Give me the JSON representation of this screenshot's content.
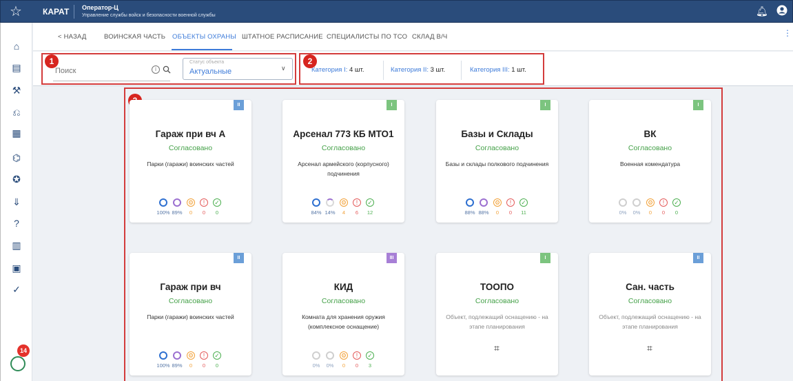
{
  "header": {
    "brand": "КАРАТ",
    "role": "Оператор-Ц",
    "department": "Управление службы войск и безопасности военной службы"
  },
  "tabs": {
    "back": "< НАЗАД",
    "items": [
      "ВОИНСКАЯ ЧАСТЬ",
      "ОБЪЕКТЫ ОХРАНЫ",
      "ШТАТНОЕ РАСПИСАНИЕ",
      "СПЕЦИАЛИСТЫ ПО ТСО",
      "СКЛАД В/Ч"
    ],
    "active": "ОБЪЕКТЫ ОХРАНЫ"
  },
  "filters": {
    "search_placeholder": "Поиск",
    "status_label": "Статус объекта",
    "status_value": "Актуальные"
  },
  "categories": [
    {
      "label": "Категория I:",
      "count": "4 шт."
    },
    {
      "label": "Категория II:",
      "count": "3 шт."
    },
    {
      "label": "Категория III:",
      "count": "1 шт."
    }
  ],
  "annotations": [
    "1",
    "2",
    "3"
  ],
  "chat_badge": "14",
  "colors": {
    "brand": "#2a4c7b",
    "accent": "#3d7bd9",
    "approved": "#43a047",
    "cat1": "#7cc47f",
    "cat2": "#6b9fd8",
    "cat3": "#a77fd6",
    "annotation": "#d33b3b"
  },
  "cards": [
    {
      "title": "Гараж при вч А",
      "status": "Согласовано",
      "category": "II",
      "desc": "Парки (гаражи) воинских частей",
      "metrics": [
        "100%",
        "89%",
        "0",
        "0",
        "0"
      ]
    },
    {
      "title": "Арсенал 773 КБ МТО1",
      "status": "Согласовано",
      "category": "I",
      "desc": "Арсенал армейского (корпусного) подчинения",
      "metrics": [
        "84%",
        "14%",
        "4",
        "6",
        "12"
      ]
    },
    {
      "title": "Базы и Склады",
      "status": "Согласовано",
      "category": "I",
      "desc": "Базы и склады полкового подчинения",
      "metrics": [
        "88%",
        "88%",
        "0",
        "0",
        "11"
      ]
    },
    {
      "title": "ВК",
      "status": "Согласовано",
      "category": "I",
      "desc": "Военная комендатура",
      "metrics": [
        "0%",
        "0%",
        "0",
        "0",
        "0"
      ]
    },
    {
      "title": "Гараж при вч",
      "status": "Согласовано",
      "category": "II",
      "desc": "Парки (гаражи) воинских частей",
      "metrics": [
        "100%",
        "89%",
        "0",
        "0",
        "0"
      ]
    },
    {
      "title": "КИД",
      "status": "Согласовано",
      "category": "III",
      "desc": "Комната для хранения оружия (комплексное оснащение)",
      "metrics": [
        "0%",
        "0%",
        "0",
        "0",
        "3"
      ]
    },
    {
      "title": "ТООПО",
      "status": "Согласовано",
      "category": "I",
      "desc": "Объект, подлежащий оснащению - на этапе планирования",
      "qr": true
    },
    {
      "title": "Сан. часть",
      "status": "Согласовано",
      "category": "II",
      "desc": "Объект, подлежащий оснащению - на этапе планирования",
      "qr": true
    }
  ]
}
